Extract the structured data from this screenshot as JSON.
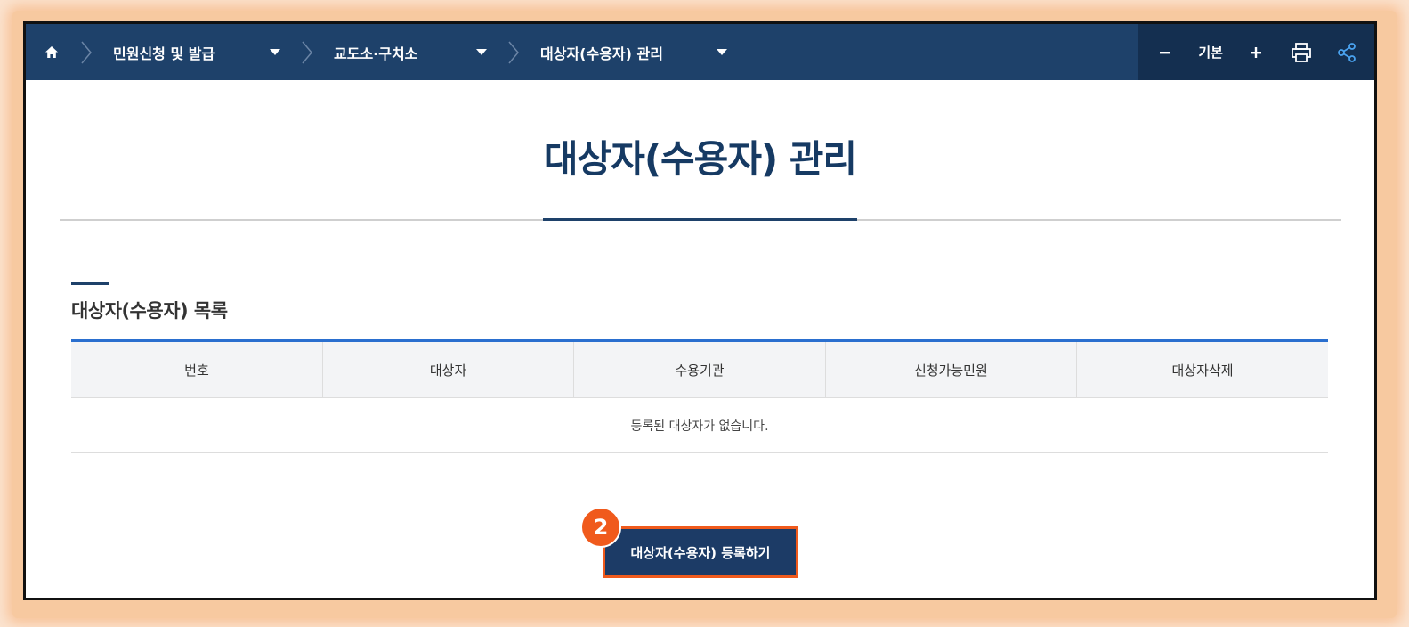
{
  "breadcrumb": {
    "items": [
      {
        "label": "민원신청 및 발급"
      },
      {
        "label": "교도소·구치소"
      },
      {
        "label": "대상자(수용자) 관리"
      }
    ]
  },
  "tools": {
    "zoom_label": "기본"
  },
  "page": {
    "title": "대상자(수용자) 관리"
  },
  "section": {
    "title": "대상자(수용자) 목록"
  },
  "table": {
    "headers": [
      "번호",
      "대상자",
      "수용기관",
      "신청가능민원",
      "대상자삭제"
    ],
    "empty_message": "등록된 대상자가 없습니다."
  },
  "register": {
    "button_label": "대상자(수용자) 등록하기",
    "step_number": "2"
  },
  "colors": {
    "nav_bg": "#1e416a",
    "tools_bg": "#142f50",
    "accent": "#2a6fcf",
    "highlight": "#f05a1c"
  },
  "icons": [
    "home-icon",
    "chevron-right-icon",
    "caret-down-icon",
    "minus-icon",
    "plus-icon",
    "print-icon",
    "share-icon"
  ]
}
